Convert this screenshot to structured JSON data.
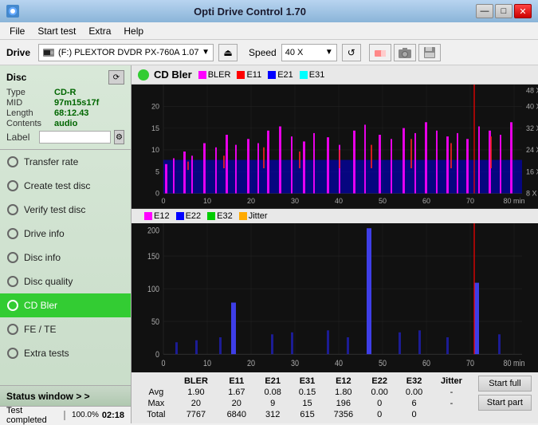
{
  "titleBar": {
    "icon": "opti-drive-icon",
    "title": "Opti Drive Control 1.70",
    "minimize": "—",
    "maximize": "□",
    "close": "✕"
  },
  "menuBar": {
    "items": [
      "File",
      "Start test",
      "Extra",
      "Help"
    ]
  },
  "driveBar": {
    "driveLabel": "Drive",
    "driveValue": "(F:)  PLEXTOR DVDR   PX-760A 1.07",
    "speedLabel": "Speed",
    "speedValue": "40 X"
  },
  "sidebar": {
    "discTitle": "Disc",
    "discProps": [
      {
        "key": "Type",
        "value": "CD-R"
      },
      {
        "key": "MID",
        "value": "97m15s17f"
      },
      {
        "key": "Length",
        "value": "68:12.43"
      },
      {
        "key": "Contents",
        "value": "audio"
      },
      {
        "key": "Label",
        "value": ""
      }
    ],
    "items": [
      {
        "label": "Transfer rate",
        "active": false
      },
      {
        "label": "Create test disc",
        "active": false
      },
      {
        "label": "Verify test disc",
        "active": false
      },
      {
        "label": "Drive info",
        "active": false
      },
      {
        "label": "Disc info",
        "active": false
      },
      {
        "label": "Disc quality",
        "active": false
      },
      {
        "label": "CD Bler",
        "active": true
      },
      {
        "label": "FE / TE",
        "active": false
      },
      {
        "label": "Extra tests",
        "active": false
      }
    ],
    "statusWindow": "Status window > >"
  },
  "statusBar": {
    "text": "Test completed",
    "progress": 100.0,
    "progressLabel": "100.0%",
    "time": "02:18"
  },
  "chart": {
    "title": "CD Bler",
    "topLegend": [
      {
        "label": "BLER",
        "color": "#ff00ff"
      },
      {
        "label": "E11",
        "color": "#ff0000"
      },
      {
        "label": "E21",
        "color": "#0000ff"
      },
      {
        "label": "E31",
        "color": "#00ffff"
      }
    ],
    "bottomLegend": [
      {
        "label": "E12",
        "color": "#ff00ff"
      },
      {
        "label": "E22",
        "color": "#0000ff"
      },
      {
        "label": "E32",
        "color": "#00ff00"
      },
      {
        "label": "Jitter",
        "color": "#ffaa00"
      }
    ],
    "topYMax": 20,
    "topYRight": [
      48,
      40,
      32,
      24,
      16,
      8
    ],
    "bottomYMax": 200,
    "xMax": 80,
    "xLabels": [
      0,
      10,
      20,
      30,
      40,
      50,
      60,
      70,
      80
    ],
    "xUnit": "min",
    "yRightUnit": "X"
  },
  "dataTable": {
    "columns": [
      "",
      "BLER",
      "E11",
      "E21",
      "E31",
      "E12",
      "E22",
      "E32",
      "Jitter"
    ],
    "rows": [
      {
        "label": "Avg",
        "bler": "1.90",
        "e11": "1.67",
        "e21": "0.08",
        "e31": "0.15",
        "e12": "1.80",
        "e22": "0.00",
        "e32": "0.00",
        "jitter": "-"
      },
      {
        "label": "Max",
        "bler": "20",
        "e11": "20",
        "e21": "9",
        "e31": "15",
        "e12": "196",
        "e22": "0",
        "e32": "6",
        "jitter": "-"
      },
      {
        "label": "Total",
        "bler": "7767",
        "e11": "6840",
        "e21": "312",
        "e31": "615",
        "e12": "7356",
        "e22": "0",
        "e32": "0",
        "jitter": ""
      }
    ],
    "buttons": [
      "Start full",
      "Start part"
    ]
  }
}
